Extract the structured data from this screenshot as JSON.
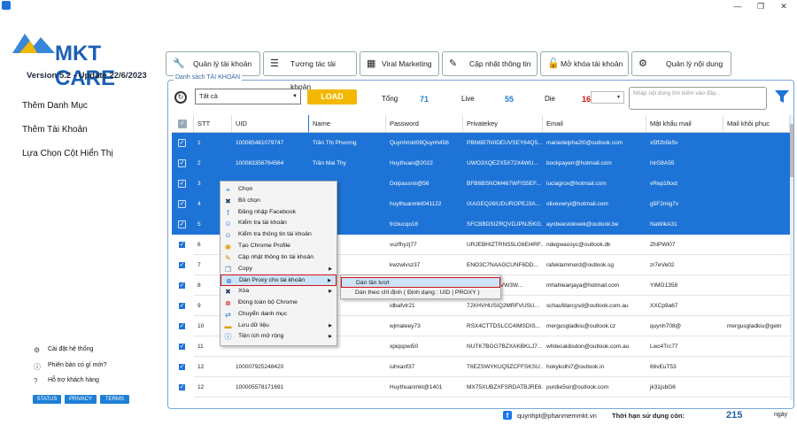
{
  "window": {
    "restore": "❐",
    "minimize": "—",
    "close": "✕"
  },
  "brand": {
    "name": "MKT CARE",
    "version": "Version  5.2  -  Update  22/6/2023",
    "accent": "#1e73d6"
  },
  "sidebar": {
    "items": [
      {
        "label": "Thêm Danh Mục"
      },
      {
        "label": "Thêm Tài Khoản"
      },
      {
        "label": "Lựa Chọn Cột Hiển Thị"
      }
    ],
    "footer": [
      {
        "label": "Cài đặt hệ thống"
      },
      {
        "label": "Phiên bản có gì mới?"
      },
      {
        "label": "Hỗ trợ khách hàng"
      }
    ],
    "badges": [
      "STATUS",
      "PRIVACY",
      "TERMS"
    ]
  },
  "tabs": [
    {
      "label": "Quản lý tài khoản",
      "icon": "wrench-icon"
    },
    {
      "label": "Tương tác tài khoản",
      "icon": "list-icon"
    },
    {
      "label": "Viral Marketing",
      "icon": "grid-icon"
    },
    {
      "label": "Cập nhật thông tin",
      "icon": "pencil-icon"
    },
    {
      "label": "Mở khóa tài khoản",
      "icon": "lock-icon"
    },
    {
      "label": "Quản lý nội dung",
      "icon": "gear-icon"
    }
  ],
  "panel": {
    "title": "Danh sách TÀI KHOẢN",
    "filter_value": "Tất cả",
    "load_label": "LOAD",
    "stats": {
      "total_label": "Tổng",
      "total": "71",
      "live_label": "Live",
      "live": "55",
      "die_label": "Die",
      "die": "16"
    },
    "search_placeholder": "Nhập nội dung tìm kiếm vào đây..."
  },
  "grid": {
    "columns": [
      "STT",
      "UID",
      "Name",
      "Password",
      "Privatekey",
      "Email",
      "Mật khẩu mail",
      "Mail khôi phục"
    ],
    "rows": [
      {
        "stt": "1",
        "uid": "100085481079747",
        "name": "Trần Thị Phương",
        "password": "Quynhmkt09Quynh456",
        "key": "PBN6B7NIIDEUVSEY64Q5...",
        "email": "mariedelpha2l0@outlook.com",
        "mailpw": "x5ff2b5k5v",
        "recovery": "",
        "selected": true
      },
      {
        "stt": "2",
        "uid": "100083356764564",
        "name": "Trần Mai Thy",
        "password": "Huythuan@2022",
        "key": "UWO3XQEZX5X72X4WU...",
        "email": "bockpayerr@hotmail.com",
        "mailpw": "hirG8A55",
        "recovery": "",
        "selected": true
      },
      {
        "stt": "3",
        "uid": "",
        "name": "Hồng Kiệt",
        "password": "Doipassroi@56",
        "key": "BFB6BSNOM467WFIS5EF...",
        "email": "luciagrox@hotmail.com",
        "mailpw": "vRep1fkxd",
        "recovery": "",
        "selected": true
      },
      {
        "stt": "4",
        "uid": "",
        "name": "",
        "password": "huythuanmkt041122",
        "key": "IXAGEQ26IUDUROPEJ3A...",
        "email": "olivevwryi@hotmail.com",
        "mailpw": "g5F2mig7v",
        "recovery": "",
        "selected": true
      },
      {
        "stt": "5",
        "uid": "",
        "name": "",
        "password": "frcbucqo16",
        "key": "SFCBBDSIZRQVDJPNJ5KG...",
        "email": "ayobeestokwek@outlook.be",
        "mailpw": "NaWikA31",
        "recovery": "",
        "selected": true
      },
      {
        "stt": "6",
        "uid": "",
        "name": "",
        "password": "vuzfhyzj77",
        "key": "URJEBHIZTRNS5LG6EI4RF...",
        "email": "ndegwaosyc@outlook.dk",
        "mailpw": "ZhlPWI07",
        "recovery": "",
        "selected": false
      },
      {
        "stt": "7",
        "uid": "",
        "name": "",
        "password": "kwzwlvsz37",
        "key": "ENO3C7NAAGCUNF6DD...",
        "email": "rafeklammerd@outlook.sg",
        "mailpw": "zr7eVe02",
        "recovery": "",
        "selected": false
      },
      {
        "stt": "8",
        "uid": "",
        "name": "",
        "password": "",
        "key": "VRWVWWWVW3W...",
        "email": "mhahleanjaya@hotmail.com",
        "mailpw": "YIMG1358",
        "recovery": "",
        "selected": false
      },
      {
        "stt": "9",
        "uid": "",
        "name": "",
        "password": "idbafvtr21",
        "key": "7JXHVHUSIQ2MRFVUSU...",
        "email": "schaufdarcysd@outlook.com.au",
        "mailpw": "XXCp9a67",
        "recovery": "",
        "selected": false
      },
      {
        "stt": "10",
        "uid": "",
        "name": "",
        "password": "wjmateey73",
        "key": "RSX4CTTDSLCC4IMSDIS...",
        "email": "mergusgladkiu@outlook.cz",
        "mailpw": "quynh708@",
        "recovery": "mergusgladkiu@getn",
        "selected": false
      },
      {
        "stt": "11",
        "uid": "",
        "name": "",
        "password": "xpiqspwi50",
        "key": "NUTK7BGG7BZXAKBKLJ7...",
        "email": "whitecaldisdon@outlook.com.au",
        "mailpw": "Lwc4Trc77",
        "recovery": "",
        "selected": false
      },
      {
        "stt": "12",
        "uid": "100007925248420",
        "name": "",
        "password": "iuhxarif37",
        "key": "T6EZSWYKUQ5ZCFFSKSU...",
        "email": "hokykolhi7@outlook.in",
        "mailpw": "66vEuT53",
        "recovery": "",
        "selected": false
      },
      {
        "stt": "12",
        "uid": "100005578171691",
        "name": "",
        "password": "Huythuanmkt@1401",
        "key": "MX75XUBZXFSRDATBJRE6...",
        "email": "purdie5sir@outlook.com",
        "mailpw": "jk31jsbG6",
        "recovery": "",
        "selected": false
      },
      {
        "stt": "13",
        "uid": "100007872624754",
        "name": "",
        "password": "hzkpqzoz28",
        "key": "GSFTGNXAVHJXDHZSA4P...",
        "email": "bragtfidgetw@outlook.com.au",
        "mailpw": "usWaVq41",
        "recovery": "",
        "selected": false
      }
    ]
  },
  "context_menu": {
    "items": [
      {
        "label": "Chọn",
        "icon": "cursor-icon",
        "sub": false
      },
      {
        "label": "Bỏ chọn",
        "icon": "x-icon",
        "sub": false
      },
      {
        "label": "Đăng nhập Facebook",
        "icon": "facebook-icon",
        "sub": false
      },
      {
        "label": "Kiểm tra tài khoản",
        "icon": "user-icon",
        "sub": false
      },
      {
        "label": "Kiểm tra thông tin tài khoản",
        "icon": "user-icon",
        "sub": false
      },
      {
        "label": "Tạo Chrome Profile",
        "icon": "chrome-icon",
        "sub": false
      },
      {
        "label": "Cập nhật thông tin tài khoản",
        "icon": "pencil-icon",
        "sub": false
      },
      {
        "label": "Copy",
        "icon": "copy-icon",
        "sub": true
      },
      {
        "label": "Dán Proxy cho tài khoản",
        "icon": "globe-icon",
        "sub": true
      },
      {
        "label": "Xóa",
        "icon": "x-icon",
        "sub": true
      },
      {
        "label": "Đóng toàn bộ Chrome",
        "icon": "stop-icon",
        "sub": false
      },
      {
        "label": "Chuyển danh mục",
        "icon": "move-icon",
        "sub": false
      },
      {
        "label": "Lưu dữ liệu",
        "icon": "folder-icon",
        "sub": true
      },
      {
        "label": "Tiện ích mở rộng",
        "icon": "info-icon",
        "sub": true
      }
    ],
    "submenu": [
      {
        "label": "Dán lần lượt"
      },
      {
        "label": "Dán theo chỉ định ( Định dạng : UID | PROXY )"
      }
    ]
  },
  "footer": {
    "email": "quynhpt@phanmemmkt.vn",
    "expiry_label": "Thời hạn sử dụng còn:",
    "days": "215",
    "unit": "ngày"
  }
}
